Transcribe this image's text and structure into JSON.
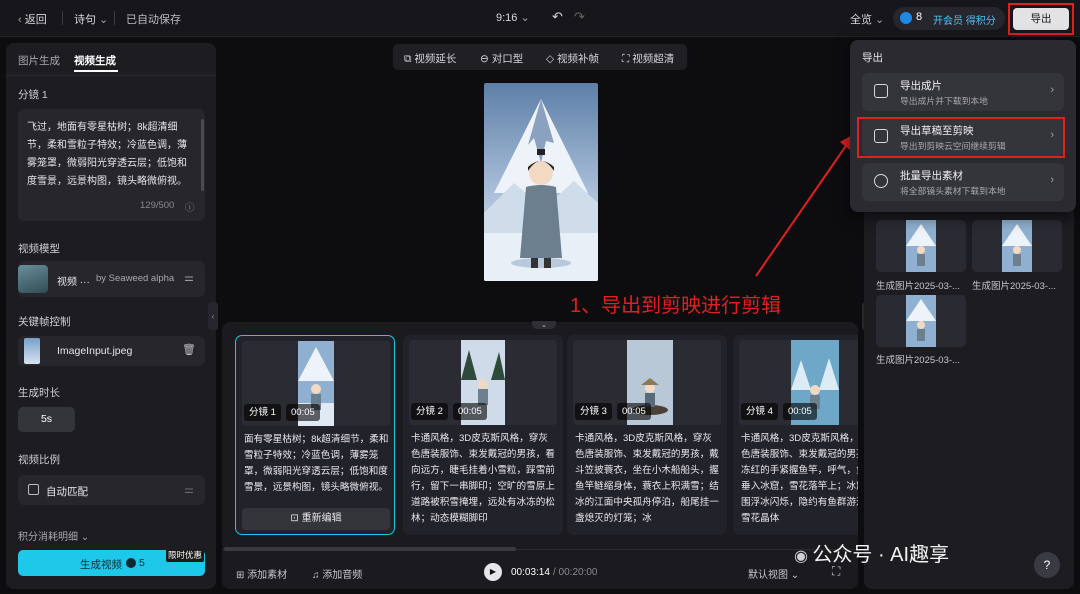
{
  "topbar": {
    "back_label": "返回",
    "project_name": "诗句",
    "save_status": "已自动保存",
    "time": "9:16",
    "zoom_label": "全览",
    "credits": "8",
    "member_label": "开会员 得积分",
    "export_label": "导出"
  },
  "left": {
    "tab_image": "图片生成",
    "tab_video": "视频生成",
    "shot_label": "分镜 1",
    "prompt_text": "飞过，地面有零星枯树；8k超清细节，柔和雪粒子特效；冷蓝色调，薄雾笼罩，微弱阳光穿透云层；低饱和度雪景，远景构图，镜头略微俯视。",
    "prompt_count": "129/500",
    "model_section": "视频模型",
    "model_name": "视频 ···",
    "model_by": "by Seaweed alpha",
    "keyframe_section": "关键帧控制",
    "keyframe_file": "ImageInput.jpeg",
    "duration_section": "生成时长",
    "duration_value": "5s",
    "ratio_section": "视频比例",
    "ratio_value": "自动匹配",
    "credit_detail": "积分消耗明细",
    "generate_label": "生成视频",
    "generate_cost": "5",
    "promo_badge": "限时优惠"
  },
  "tools": {
    "extend": "视频延长",
    "lipsync": "对口型",
    "interp": "视频补帧",
    "upscale": "视频超清"
  },
  "annotation": "1、导出到剪映进行剪辑",
  "cards": [
    {
      "tag": "分镜 1",
      "time": "00:05",
      "text": "面有零星枯树；8k超清细节，柔和雪粒子特效；冷蓝色调，薄雾笼罩，微弱阳光穿透云层；低饱和度雪景，远景构图，镜头略微俯视。",
      "button": "重新编辑"
    },
    {
      "tag": "分镜 2",
      "time": "00:05",
      "text": "卡通风格，3D皮克斯风格，穿灰色唐装服饰、束发戴冠的男孩，看向远方，睫毛挂着小雪粒，踩雪前行，留下一串脚印；空旷的雪原上道路被积雪掩埋，远处有冰冻的松林；动态模糊脚印"
    },
    {
      "tag": "分镜 3",
      "time": "00:05",
      "text": "卡通风格，3D皮克斯风格，穿灰色唐装服饰、束发戴冠的男孩，戴斗笠披蓑衣，坐在小木船船头，握鱼竿鲢缩身体，蓑衣上积满雪；结冰的江面中央孤舟停泊，船尾挂一盏熄灭的灯笼；冰"
    },
    {
      "tag": "分镜 4",
      "time": "00:05",
      "text": "卡通风格，3D皮克斯风格，穿灰色唐装服饰、束发戴冠的男孩，冻红的手紧握鱼竿，呼气，鱼线垂入冰窟，雪花落竿上；冰窟周围浮冰闪烁，隐约有鱼群游过；雪花晶体"
    }
  ],
  "bottom": {
    "add_material": "添加素材",
    "add_audio": "添加音频",
    "current_time": "00:03:14",
    "total_time": "/ 00:20:00",
    "view_mode": "默认视图"
  },
  "gallery": [
    {
      "caption": "生成图片2025-03-..."
    },
    {
      "caption": "生成图片2025-03-..."
    },
    {
      "caption": "生成图片2025-03-..."
    }
  ],
  "export_menu": {
    "heading": "导出",
    "items": [
      {
        "title": "导出成片",
        "sub": "导出成片并下载到本地"
      },
      {
        "title": "导出草稿至剪映",
        "sub": "导出到剪映云空间继续剪辑"
      },
      {
        "title": "批量导出素材",
        "sub": "将全部镜头素材下载到本地"
      }
    ]
  },
  "watermark": "公众号 · AI趣享",
  "help": "?",
  "colors": {
    "accent": "#1ec8e8",
    "highlight": "#e02020",
    "promo": "#1a1a1a"
  }
}
